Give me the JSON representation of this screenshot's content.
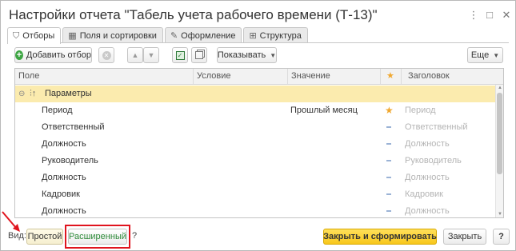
{
  "window": {
    "title": "Настройки отчета \"Табель учета рабочего времени (Т-13)\"",
    "controls": {
      "more": "⋮",
      "maximize": "□",
      "close": "✕"
    }
  },
  "tabs": [
    {
      "label": "Отборы",
      "icon": "filter-icon",
      "active": true
    },
    {
      "label": "Поля и сортировки",
      "icon": "table-icon",
      "active": false
    },
    {
      "label": "Оформление",
      "icon": "brush-icon",
      "active": false
    },
    {
      "label": "Структура",
      "icon": "structure-icon",
      "active": false
    }
  ],
  "toolbar": {
    "add_filter": "Добавить отбор",
    "show": "Показывать",
    "more": "Еще"
  },
  "grid": {
    "columns": {
      "field": "Поле",
      "condition": "Условие",
      "value": "Значение",
      "star": "★",
      "header": "Заголовок"
    },
    "group": {
      "label": "Параметры"
    },
    "rows": [
      {
        "field": "Период",
        "value": "Прошлый месяц",
        "mark": "star",
        "header": "Период"
      },
      {
        "field": "Ответственный",
        "value": "",
        "mark": "dash",
        "header": "Ответственный"
      },
      {
        "field": "Должность",
        "value": "",
        "mark": "dash",
        "header": "Должность"
      },
      {
        "field": "Руководитель",
        "value": "",
        "mark": "dash",
        "header": "Руководитель"
      },
      {
        "field": "Должность",
        "value": "",
        "mark": "dash",
        "header": "Должность"
      },
      {
        "field": "Кадровик",
        "value": "",
        "mark": "dash",
        "header": "Кадровик"
      },
      {
        "field": "Должность",
        "value": "",
        "mark": "dash",
        "header": "Должность"
      }
    ]
  },
  "footer": {
    "view_label": "Вид:",
    "simple": "Простой",
    "extended": "Расширенный",
    "help_q": "?",
    "close_and_generate": "Закрыть и сформировать",
    "close": "Закрыть",
    "help": "?"
  },
  "colors": {
    "group_row": "#fbebae",
    "primary_button": "#f8c71b",
    "highlight": "#e0141e",
    "extended_text": "#2e8b3a"
  }
}
